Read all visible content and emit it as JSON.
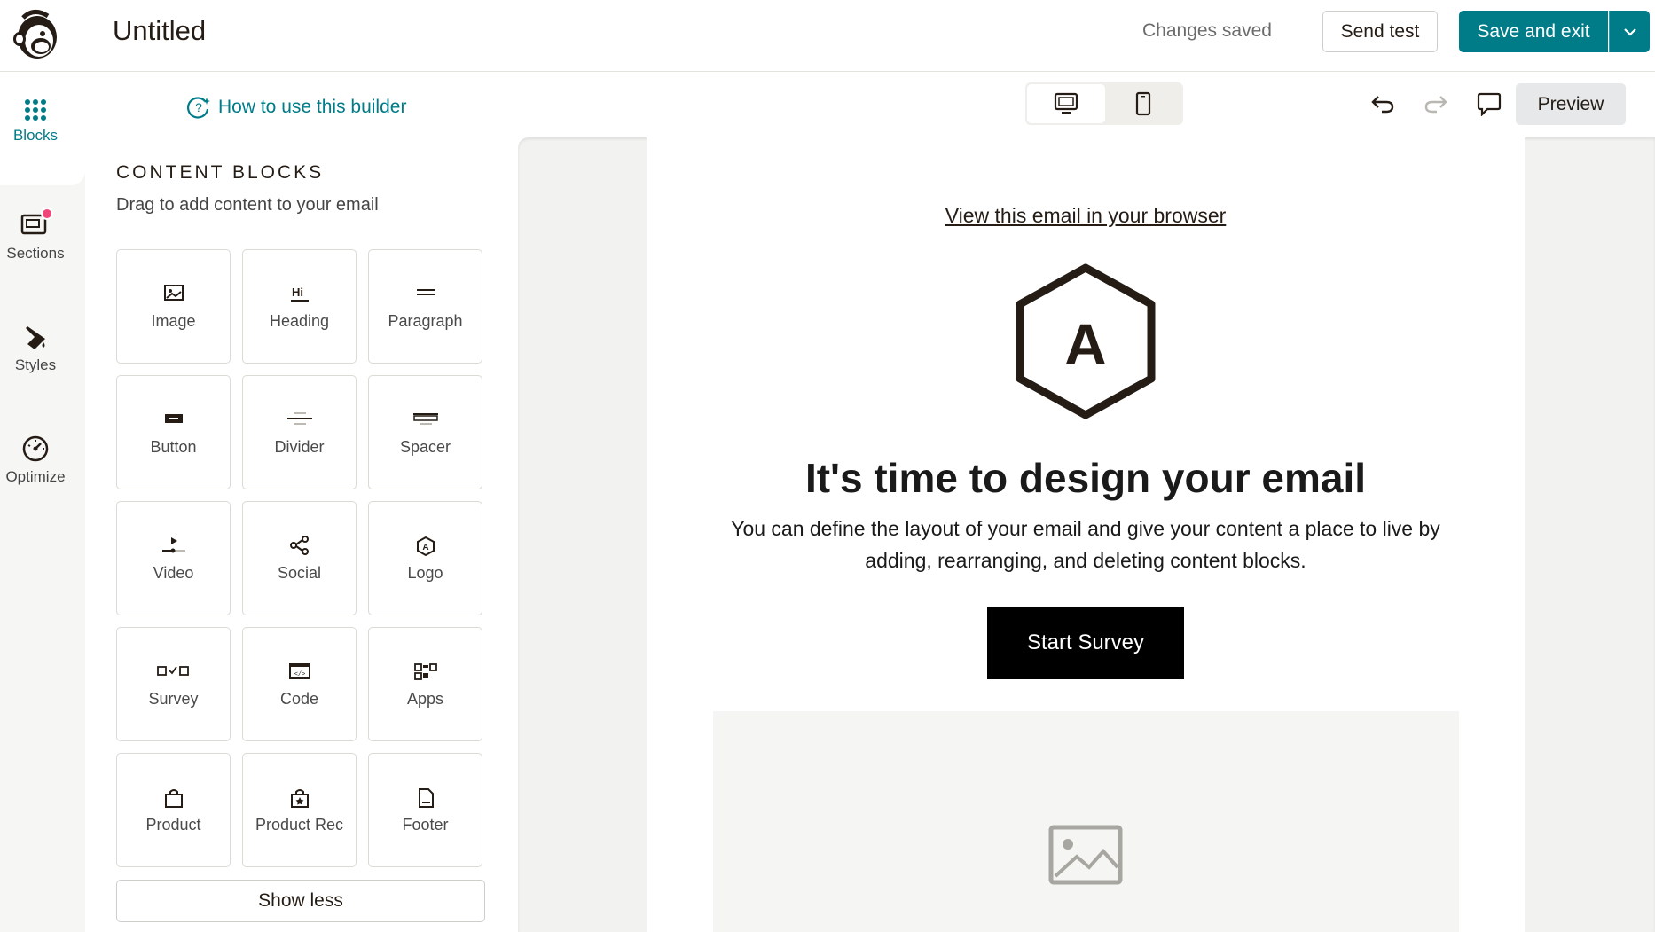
{
  "header": {
    "title": "Untitled",
    "status": "Changes saved",
    "send_test": "Send test",
    "save_exit": "Save and exit"
  },
  "rail": {
    "items": [
      {
        "label": "Blocks",
        "icon": "grid-dots-icon"
      },
      {
        "label": "Sections",
        "icon": "sections-icon"
      },
      {
        "label": "Styles",
        "icon": "paint-bucket-icon"
      },
      {
        "label": "Optimize",
        "icon": "gauge-icon"
      }
    ]
  },
  "panel": {
    "howto": "How to use this builder",
    "title": "CONTENT BLOCKS",
    "subtitle": "Drag to add content to your email",
    "blocks": [
      {
        "label": "Image"
      },
      {
        "label": "Heading"
      },
      {
        "label": "Paragraph"
      },
      {
        "label": "Button"
      },
      {
        "label": "Divider"
      },
      {
        "label": "Spacer"
      },
      {
        "label": "Video"
      },
      {
        "label": "Social"
      },
      {
        "label": "Logo"
      },
      {
        "label": "Survey"
      },
      {
        "label": "Code"
      },
      {
        "label": "Apps"
      },
      {
        "label": "Product"
      },
      {
        "label": "Product Rec"
      },
      {
        "label": "Footer"
      }
    ],
    "show_less": "Show less"
  },
  "toolbar": {
    "preview": "Preview"
  },
  "email": {
    "view_browser": "View this email in your browser",
    "logo_letter": "A",
    "headline": "It's time to design your email",
    "body": "You can define the layout of your email and give your content a place to live by adding, rearranging, and deleting content blocks.",
    "cta": "Start Survey"
  },
  "colors": {
    "accent": "#007c89",
    "notification": "#f0467a"
  }
}
